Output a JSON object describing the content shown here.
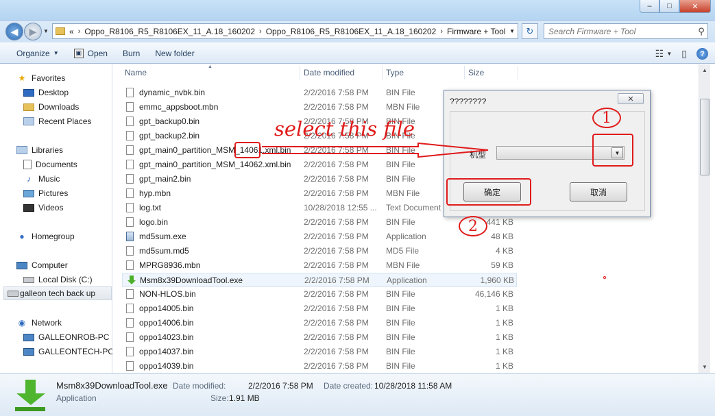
{
  "window": {
    "minimize": "–",
    "maximize": "□",
    "close": "✕"
  },
  "address": {
    "overflow": "«",
    "crumbs": [
      "Oppo_R8106_R5_R8106EX_11_A.18_160202",
      "Oppo_R8106_R5_R8106EX_11_A.18_160202",
      "Firmware + Tool"
    ],
    "search_placeholder": "Search Firmware + Tool"
  },
  "toolbar": {
    "organize": "Organize",
    "open": "Open",
    "burn": "Burn",
    "new_folder": "New folder"
  },
  "nav": {
    "favorites": "Favorites",
    "desktop": "Desktop",
    "downloads": "Downloads",
    "recent": "Recent Places",
    "libraries": "Libraries",
    "documents": "Documents",
    "music": "Music",
    "pictures": "Pictures",
    "videos": "Videos",
    "homegroup": "Homegroup",
    "computer": "Computer",
    "local_disk": "Local Disk (C:)",
    "removable": "galleon tech back up",
    "network": "Network",
    "pc1": "GALLEONROB-PC",
    "pc2": "GALLEONTECH-PC"
  },
  "columns": {
    "name": "Name",
    "date": "Date modified",
    "type": "Type",
    "size": "Size"
  },
  "files": [
    {
      "name": "dynamic_nvbk.bin",
      "date": "2/2/2016 7:58 PM",
      "type": "BIN File",
      "size": "",
      "icon": "file"
    },
    {
      "name": "emmc_appsboot.mbn",
      "date": "2/2/2016 7:58 PM",
      "type": "MBN File",
      "size": "",
      "icon": "file"
    },
    {
      "name": "gpt_backup0.bin",
      "date": "2/2/2016 7:58 PM",
      "type": "BIN File",
      "size": "",
      "icon": "file"
    },
    {
      "name": "gpt_backup2.bin",
      "date": "2/2/2016 7:58 PM",
      "type": "BIN File",
      "size": "",
      "icon": "file"
    },
    {
      "name": "gpt_main0_partition_MSM_14061.xml.bin",
      "date": "2/2/2016 7:58 PM",
      "type": "BIN File",
      "size": "",
      "icon": "file"
    },
    {
      "name": "gpt_main0_partition_MSM_14062.xml.bin",
      "date": "2/2/2016 7:58 PM",
      "type": "BIN File",
      "size": "",
      "icon": "file"
    },
    {
      "name": "gpt_main2.bin",
      "date": "2/2/2016 7:58 PM",
      "type": "BIN File",
      "size": "",
      "icon": "file"
    },
    {
      "name": "hyp.mbn",
      "date": "2/2/2016 7:58 PM",
      "type": "MBN File",
      "size": "",
      "icon": "file"
    },
    {
      "name": "log.txt",
      "date": "10/28/2018 12:55 ...",
      "type": "Text Document",
      "size": "",
      "icon": "file"
    },
    {
      "name": "logo.bin",
      "date": "2/2/2016 7:58 PM",
      "type": "BIN File",
      "size": "441 KB",
      "icon": "file"
    },
    {
      "name": "md5sum.exe",
      "date": "2/2/2016 7:58 PM",
      "type": "Application",
      "size": "48 KB",
      "icon": "exe"
    },
    {
      "name": "md5sum.md5",
      "date": "2/2/2016 7:58 PM",
      "type": "MD5 File",
      "size": "4 KB",
      "icon": "file"
    },
    {
      "name": "MPRG8936.mbn",
      "date": "2/2/2016 7:58 PM",
      "type": "MBN File",
      "size": "59 KB",
      "icon": "file"
    },
    {
      "name": "Msm8x39DownloadTool.exe",
      "date": "2/2/2016 7:58 PM",
      "type": "Application",
      "size": "1,960 KB",
      "icon": "dl"
    },
    {
      "name": "NON-HLOS.bin",
      "date": "2/2/2016 7:58 PM",
      "type": "BIN File",
      "size": "46,146 KB",
      "icon": "file"
    },
    {
      "name": "oppo14005.bin",
      "date": "2/2/2016 7:58 PM",
      "type": "BIN File",
      "size": "1 KB",
      "icon": "file"
    },
    {
      "name": "oppo14006.bin",
      "date": "2/2/2016 7:58 PM",
      "type": "BIN File",
      "size": "1 KB",
      "icon": "file"
    },
    {
      "name": "oppo14023.bin",
      "date": "2/2/2016 7:58 PM",
      "type": "BIN File",
      "size": "1 KB",
      "icon": "file"
    },
    {
      "name": "oppo14037.bin",
      "date": "2/2/2016 7:58 PM",
      "type": "BIN File",
      "size": "1 KB",
      "icon": "file"
    },
    {
      "name": "oppo14039.bin",
      "date": "2/2/2016 7:58 PM",
      "type": "BIN File",
      "size": "1 KB",
      "icon": "file"
    }
  ],
  "details": {
    "filename": "Msm8x39DownloadTool.exe",
    "type": "Application",
    "modified_label": "Date modified:",
    "modified_value": "2/2/2016 7:58 PM",
    "created_label": "Date created:",
    "created_value": "10/28/2018 11:58 AM",
    "size_label": "Size:",
    "size_value": "1.91 MB"
  },
  "dialog": {
    "title": "????????",
    "close": "✕",
    "label": "机型",
    "ok": "确定",
    "cancel": "取消"
  },
  "annotations": {
    "instruction": "select this file",
    "step1": "1",
    "step2": "2",
    "highlight": "14061",
    "color": "#e01b1b"
  },
  "icons": {
    "search": "search-icon",
    "refresh": "refresh-icon",
    "help": "help-icon"
  }
}
